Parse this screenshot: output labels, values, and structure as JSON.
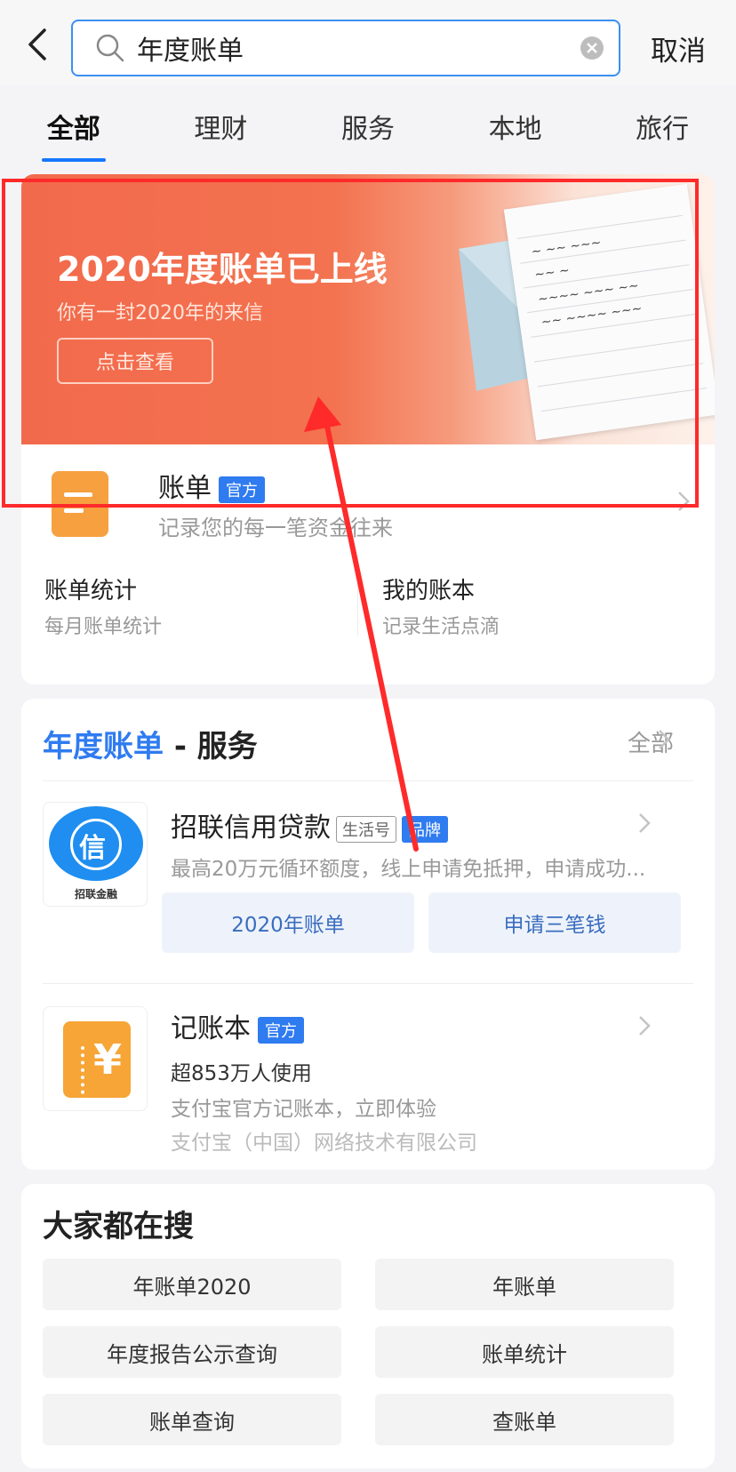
{
  "search": {
    "query": "年度账单",
    "cancel": "取消"
  },
  "tabs": [
    {
      "label": "全部",
      "active": true
    },
    {
      "label": "理财"
    },
    {
      "label": "服务"
    },
    {
      "label": "本地"
    },
    {
      "label": "旅行"
    }
  ],
  "banner": {
    "title": "2020年度账单已上线",
    "subtitle": "你有一封2020年的来信",
    "button": "点击查看"
  },
  "bill_app": {
    "name": "账单",
    "badge": "官方",
    "desc": "记录您的每一笔资金往来",
    "shortcuts": [
      {
        "title": "账单统计",
        "sub": "每月账单统计"
      },
      {
        "title": "我的账本",
        "sub": "记录生活点滴"
      }
    ]
  },
  "services": {
    "title_highlight": "年度账单",
    "title_rest": " - 服务",
    "all": "全部",
    "items": [
      {
        "name": "招联信用贷款",
        "tag_life": "生活号",
        "tag_brand": "品牌",
        "desc": "最高20万元循环额度，线上申请免抵押，申请成功...",
        "icon_char": "信",
        "icon_brand": "招联金融",
        "buttons": [
          "2020年账单",
          "申请三笔钱"
        ]
      },
      {
        "name": "记账本",
        "badge": "官方",
        "users": "超853万人使用",
        "desc": "支付宝官方记账本，立即体验",
        "company": "支付宝（中国）网络技术有限公司",
        "icon_char": "¥"
      }
    ]
  },
  "hot_search": {
    "title": "大家都在搜",
    "items": [
      "年账单2020",
      "年账单",
      "年度报告公示查询",
      "账单统计",
      "账单查询",
      "查账单"
    ]
  },
  "colors": {
    "accent": "#2f7bf0",
    "banner": "#f26a4c",
    "annotation": "#ff2a2a"
  }
}
